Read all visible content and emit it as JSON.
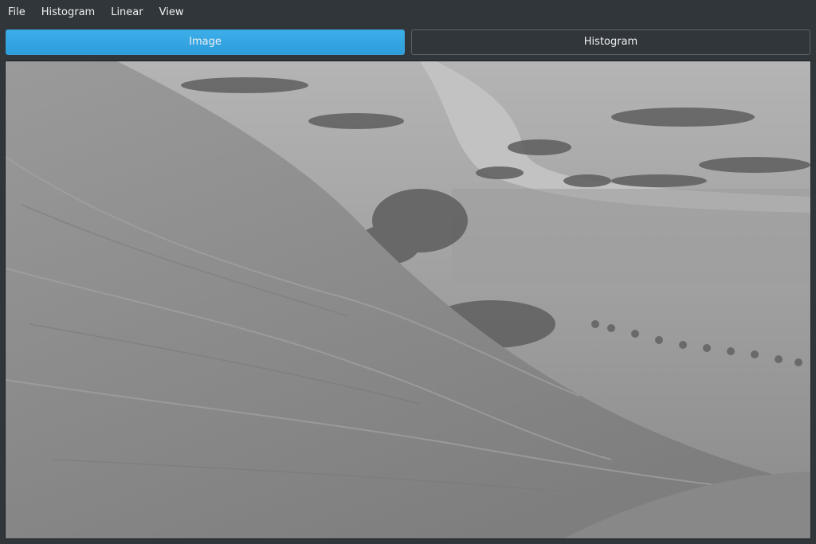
{
  "menubar": {
    "items": [
      {
        "label": "File"
      },
      {
        "label": "Histogram"
      },
      {
        "label": "Linear"
      },
      {
        "label": "View"
      }
    ]
  },
  "tabs": [
    {
      "label": "Image",
      "active": true
    },
    {
      "label": "Histogram",
      "active": false
    }
  ],
  "image": {
    "description_name": "grayscale-landscape-photo",
    "tone": "grayscale"
  },
  "colors": {
    "window_bg": "#31363b",
    "accent": "#3daee9",
    "text": "#eff0f1",
    "border": "#5b6167"
  }
}
